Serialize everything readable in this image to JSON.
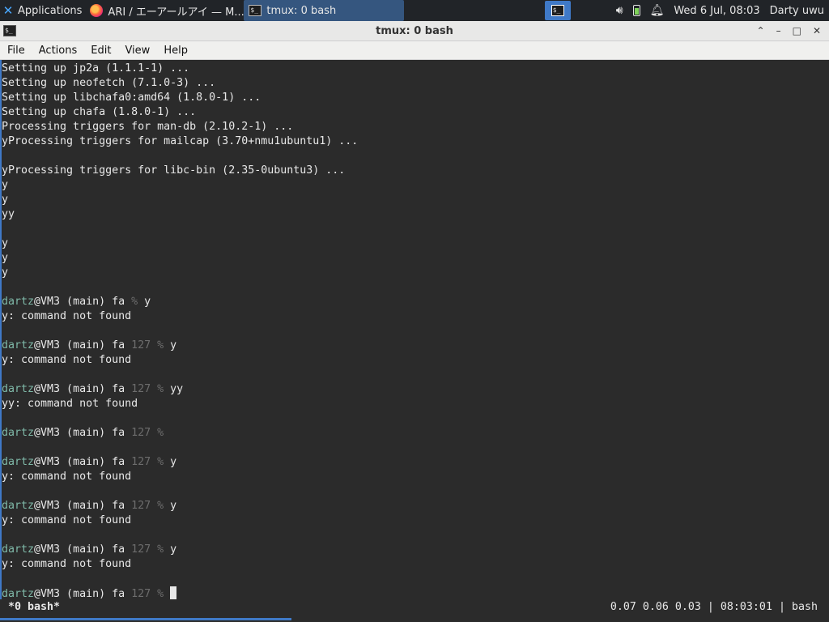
{
  "taskbar": {
    "apps_label": "Applications",
    "tasks": [
      {
        "label": "ARI / エーアールアイ — M...",
        "icon": "firefox-icon"
      },
      {
        "label": "tmux: 0 bash",
        "icon": "terminal-icon"
      }
    ],
    "clock": "Wed  6 Jul, 08:03",
    "user": "Darty uwu"
  },
  "window": {
    "title": "tmux: 0 bash",
    "controls": {
      "shade": "⌃",
      "minimize": "–",
      "maximize": "□",
      "close": "✕"
    }
  },
  "menu": {
    "items": [
      "File",
      "Actions",
      "Edit",
      "View",
      "Help"
    ]
  },
  "terminal": {
    "lines": [
      {
        "text": "Setting up jp2a (1.1.1-1) ..."
      },
      {
        "text": "Setting up neofetch (7.1.0-3) ..."
      },
      {
        "text": "Setting up libchafa0:amd64 (1.8.0-1) ..."
      },
      {
        "text": "Setting up chafa (1.8.0-1) ..."
      },
      {
        "text": "Processing triggers for man-db (2.10.2-1) ..."
      },
      {
        "text": "yProcessing triggers for mailcap (3.70+nmu1ubuntu1) ..."
      },
      {
        "text": ""
      },
      {
        "text": "yProcessing triggers for libc-bin (2.35-0ubuntu3) ..."
      },
      {
        "text": "y"
      },
      {
        "text": "y"
      },
      {
        "text": "yy"
      },
      {
        "text": ""
      },
      {
        "text": "y"
      },
      {
        "text": "y"
      },
      {
        "text": "y"
      },
      {
        "text": ""
      },
      {
        "prompt": {
          "user": "dartz",
          "host": "@VM3 (main) fa ",
          "code": "",
          "sym": "% ",
          "cmd": "y"
        }
      },
      {
        "text": "y: command not found"
      },
      {
        "text": ""
      },
      {
        "prompt": {
          "user": "dartz",
          "host": "@VM3 (main) fa ",
          "code": "127 ",
          "sym": "% ",
          "cmd": "y"
        }
      },
      {
        "text": "y: command not found"
      },
      {
        "text": ""
      },
      {
        "prompt": {
          "user": "dartz",
          "host": "@VM3 (main) fa ",
          "code": "127 ",
          "sym": "% ",
          "cmd": "yy"
        }
      },
      {
        "text": "yy: command not found"
      },
      {
        "text": ""
      },
      {
        "prompt": {
          "user": "dartz",
          "host": "@VM3 (main) fa ",
          "code": "127 ",
          "sym": "% ",
          "cmd": ""
        }
      },
      {
        "text": ""
      },
      {
        "prompt": {
          "user": "dartz",
          "host": "@VM3 (main) fa ",
          "code": "127 ",
          "sym": "% ",
          "cmd": "y"
        }
      },
      {
        "text": "y: command not found"
      },
      {
        "text": ""
      },
      {
        "prompt": {
          "user": "dartz",
          "host": "@VM3 (main) fa ",
          "code": "127 ",
          "sym": "% ",
          "cmd": "y"
        }
      },
      {
        "text": "y: command not found"
      },
      {
        "text": ""
      },
      {
        "prompt": {
          "user": "dartz",
          "host": "@VM3 (main) fa ",
          "code": "127 ",
          "sym": "% ",
          "cmd": "y"
        }
      },
      {
        "text": "y: command not found"
      },
      {
        "text": ""
      },
      {
        "prompt": {
          "user": "dartz",
          "host": "@VM3 (main) fa ",
          "code": "127 ",
          "sym": "% ",
          "cmd": ""
        },
        "cursor": true
      }
    ]
  },
  "tmux_status": {
    "window": " *0 bash*",
    "right": "0.07 0.06 0.03 | 08:03:01 | bash"
  },
  "colors": {
    "accent": "#3f79c7",
    "terminal_bg": "#2b2b2b",
    "prompt_user": "#7fb9a8",
    "prompt_code": "#6d6d6d"
  }
}
